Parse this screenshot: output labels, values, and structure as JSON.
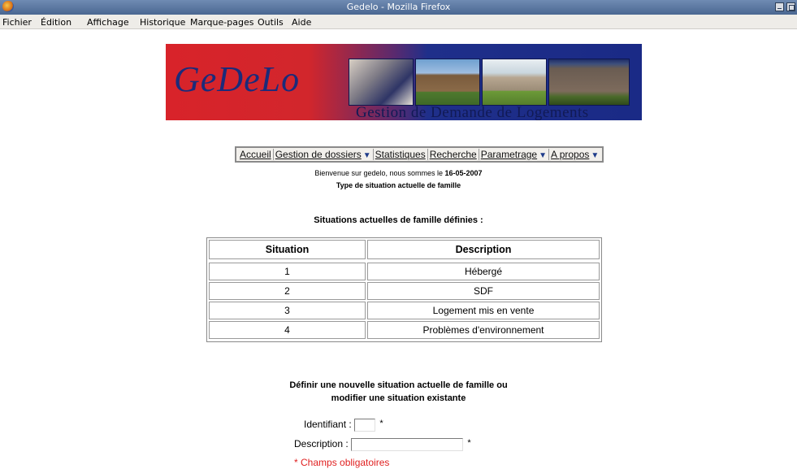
{
  "window": {
    "title": "Gedelo - Mozilla Firefox"
  },
  "menubar": {
    "items": [
      "Fichier",
      "Édition",
      "Affichage",
      "Historique",
      "Marque-pages",
      "Outils",
      "Aide"
    ]
  },
  "banner": {
    "logo": "GeDeLo",
    "subtitle": "Gestion de Demande de Logements"
  },
  "nav": {
    "items": [
      {
        "label": "Accueil"
      },
      {
        "label": "Gestion de dossiers"
      },
      {
        "label": "Statistiques"
      },
      {
        "label": "Recherche"
      },
      {
        "label": "Parametrage"
      },
      {
        "label": "A propos"
      }
    ],
    "arrow": "▼"
  },
  "welcome": {
    "text": "Bienvenue sur gedelo, nous sommes le ",
    "date": "16-05-2007"
  },
  "page_subtitle": "Type de situation actuelle de famille",
  "table": {
    "title": "Situations actuelles de famille définies :",
    "headers": [
      "Situation",
      "Description"
    ],
    "rows": [
      [
        "1",
        "Hébergé"
      ],
      [
        "2",
        "SDF"
      ],
      [
        "3",
        "Logement mis en vente"
      ],
      [
        "4",
        "Problèmes d'environnement"
      ]
    ]
  },
  "form": {
    "title_line1": "Définir une nouvelle situation actuelle de famille ou",
    "title_line2": "modifier une situation existante",
    "id_label": "Identifiant :",
    "id_value": "",
    "desc_label": "Description :",
    "desc_value": "",
    "required_marker": "*",
    "required_note": "* Champs obligatoires"
  }
}
